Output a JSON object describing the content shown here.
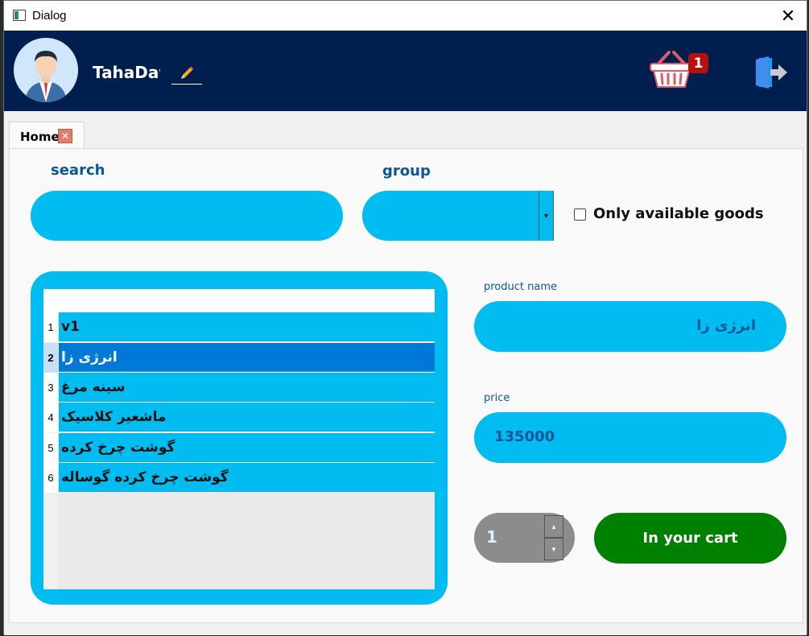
{
  "window": {
    "title": "Dialog",
    "close_glyph": "✕"
  },
  "header": {
    "username": "TahaDav",
    "cart_count": "1"
  },
  "tabs": [
    {
      "label": "Home",
      "close_glyph": "✕"
    }
  ],
  "search": {
    "label": "search",
    "value": ""
  },
  "group": {
    "label": "group",
    "selected": ""
  },
  "filter": {
    "checkbox_label": "Only available goods",
    "checked": false
  },
  "products": {
    "rows": [
      {
        "num": "1",
        "name": "v1"
      },
      {
        "num": "2",
        "name": "انرژی زا"
      },
      {
        "num": "3",
        "name": "سینه مرغ"
      },
      {
        "num": "4",
        "name": "ماشعیر کلاسیک"
      },
      {
        "num": "5",
        "name": "گوشت چرخ کرده"
      },
      {
        "num": "6",
        "name": "گوشت چرخ کرده گوساله"
      }
    ],
    "selected_row": 2
  },
  "details": {
    "product_name_label": "product name",
    "product_name_value": "انرژی زا",
    "price_label": "price",
    "price_value": "135000"
  },
  "quantity": {
    "value": "1",
    "up_glyph": "▲",
    "down_glyph": "▼"
  },
  "cart_button": {
    "label": "In your cart"
  },
  "colors": {
    "header_bg": "#001e4e",
    "accent": "#00bcf0",
    "label_blue": "#0b5796",
    "cart_green": "#008000",
    "selection": "#0078d7"
  },
  "icons": [
    "app-icon",
    "close-icon",
    "avatar",
    "pencil-icon",
    "basket-icon",
    "exit-door-icon",
    "tab-close-icon",
    "dropdown-arrow-icon"
  ]
}
